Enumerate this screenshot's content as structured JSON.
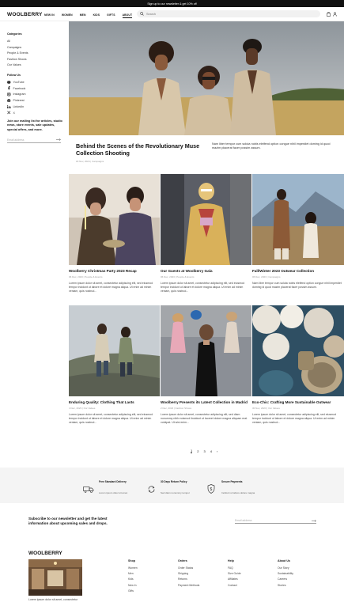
{
  "topbar": {
    "text": "Sign up to our newsletter & get 10% off"
  },
  "header": {
    "logo": "WOOLBERRY",
    "nav": [
      "NEW IN",
      "WOMEN",
      "MEN",
      "KIDS",
      "GIFTS",
      "ABOUT"
    ],
    "active_nav": "ABOUT",
    "search_placeholder": "Search"
  },
  "sidebar": {
    "categories_heading": "Categories",
    "categories": [
      "All",
      "Campaigns",
      "People & Events",
      "Fashion Shows",
      "Our Values"
    ],
    "follow_heading": "Follow Us",
    "social": [
      "YouTube",
      "Facebook",
      "Instagram",
      "Pinterest",
      "LinkedIn",
      "X"
    ],
    "mailing_text": "Join our mailing list for articles, studio news, store events, sale updates, special offers, and more.",
    "email_placeholder": "Email address"
  },
  "hero": {
    "title": "Behind the Scenes of the Revolutionary Muse Collection Shooting",
    "date": "18 Nov, 2024 | Campaigns",
    "description": "Nam liber tempor cum soluta nobis eleifend option congue nihil imperdiet doming id quod mazim placerat facer possim assum."
  },
  "articles": [
    {
      "title": "Woolberry Christmas Party 2023 Recap",
      "meta": "06 Dec, 2023 | People & Events",
      "excerpt": "Lorem ipsum dolor sit amet, consectetur adipiscing elit, sed eiusmod tempor incidunt ut labore et dolore magna aliqua. Ut enim ad minim veniam, quis nostrud..."
    },
    {
      "title": "Our Guests at Woolberry Gala",
      "meta": "06 Dec, 2023 | People & Events",
      "excerpt": "Lorem ipsum dolor sit amet, consectetur adipiscing elit, sed eiusmod tempor incidunt ut labore et dolore magna aliqua. Ut enim ad minim veniam, quis nostrud..."
    },
    {
      "title": "Fall/Winter 2023 Outwear Collection",
      "meta": "06 Dec, 2023 | Campaigns",
      "excerpt": "Nam liber tempor cum soluta nobis eleifend option congue nihil imperdiet doming id quod mazim placerat facer possim assum."
    },
    {
      "title": "Enduring Quality: Clothing That Lasts",
      "meta": "4 Dec, 2023 | Our Values",
      "excerpt": "Lorem ipsum dolor sit amet, consectetur adipiscing elit, sed eiusmod tempor incidunt ut labore et dolore magna aliqua. Ut enim ad minim veniam, quis nostrud..."
    },
    {
      "title": "Woolberry Presents its Latest Collection in Madrid",
      "meta": "2 Dec, 2023 | Fashion Shows",
      "excerpt": "Lorem ipsum dolor sit amet, consectetur adipiscing elit, sed diam nonummy nibh euismod tincidunt ut laoreet dolore magna aliquam erat volutpat. Ut wisi enim..."
    },
    {
      "title": "Eco-Chic: Crafting More Sustainable Outwear",
      "meta": "30 Nov, 2023 | Our Values",
      "excerpt": "Lorem ipsum dolor sit amet, consectetur adipiscing elit, sed eiusmod tempor incidunt ut labore et dolore magna aliqua. Ut enim ad minim veniam, quis nostrud..."
    }
  ],
  "pagination": {
    "pages": [
      "1",
      "2",
      "3",
      "4"
    ],
    "current": "1",
    "next": "›"
  },
  "perks": [
    {
      "title": "Free Standard Delivery",
      "text": "Lorem ipsum dolor sit amet"
    },
    {
      "title": "30 Days Return Policy",
      "text": "Sed diam nonummy tempor"
    },
    {
      "title": "Secure Payments",
      "text": "Incidunt ut labore dolore magna"
    }
  ],
  "newsletter": {
    "text": "Subscribe to our newsletter and get the latest information about upcoming sales and drops.",
    "placeholder": "Email address"
  },
  "footer": {
    "logo": "WOOLBERRY",
    "caption": "Lorem ipsum dolor sit amet, consectetur",
    "columns": [
      {
        "heading": "Shop",
        "links": [
          "Women",
          "Men",
          "Kids",
          "New In",
          "Gifts"
        ]
      },
      {
        "heading": "Orders",
        "links": [
          "Order Status",
          "Shipping",
          "Returns",
          "Payment Methods"
        ]
      },
      {
        "heading": "Help",
        "links": [
          "FAQ",
          "Size Guide",
          "Affiliates",
          "Contact"
        ]
      },
      {
        "heading": "About Us",
        "links": [
          "Our Story",
          "Sustainability",
          "Careers",
          "Stories"
        ]
      }
    ]
  }
}
